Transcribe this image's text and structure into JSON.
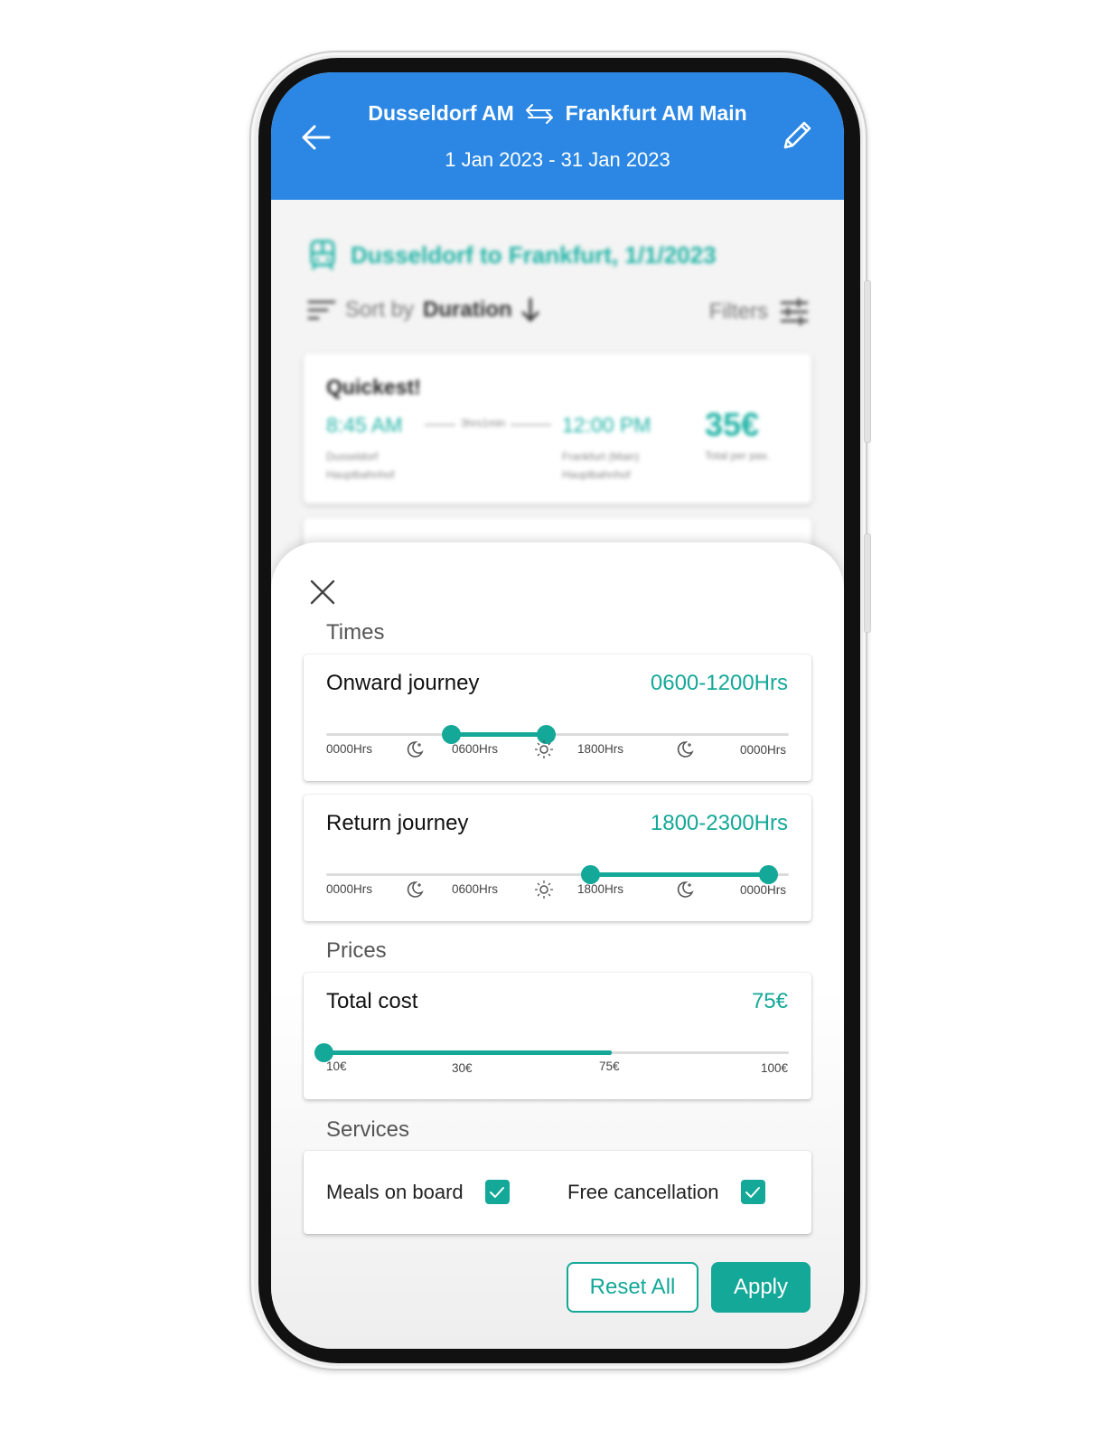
{
  "header": {
    "origin": "Dusseldorf AM",
    "destination": "Frankfurt AM Main",
    "date_range": "1 Jan 2023 - 31 Jan 2023",
    "background_color": "#2b87e3"
  },
  "results": {
    "title": "Dusseldorf to Frankfurt, 1/1/2023",
    "sort_prefix": "Sort by",
    "sort_value": "Duration",
    "filters_label": "Filters",
    "cards": [
      {
        "badge": "Quickest!",
        "departure_time": "8:45 AM",
        "duration": "3hrs1min",
        "arrival_time": "12:00 PM",
        "departure_station": "Dusseldorf Hauptbahnhof",
        "arrival_station": "Frankfurt (Main) Hauptbahnhof",
        "price": "35€",
        "price_note": "Total per pax."
      }
    ]
  },
  "filters": {
    "times_label": "Times",
    "onward": {
      "title": "Onward journey",
      "value": "0600-1200Hrs",
      "range_fraction": [
        0.27,
        0.475
      ]
    },
    "return": {
      "title": "Return journey",
      "value": "1800-2300Hrs",
      "range_fraction": [
        0.57,
        0.955
      ]
    },
    "time_ticks": [
      "0000Hrs",
      "0600Hrs",
      "1800Hrs",
      "0000Hrs"
    ],
    "time_icons": [
      "moon-icon",
      "sun-icon",
      "moon-icon"
    ],
    "prices_label": "Prices",
    "total_cost": {
      "title": "Total cost",
      "value": "75€",
      "fill_fraction": 0.62,
      "ticks": [
        "10€",
        "30€",
        "75€",
        "100€"
      ]
    },
    "services_label": "Services",
    "services": [
      {
        "label": "Meals on board",
        "checked": true
      },
      {
        "label": "Free cancellation",
        "checked": true
      }
    ],
    "reset_label": "Reset All",
    "apply_label": "Apply",
    "accent_color": "#14a898"
  }
}
